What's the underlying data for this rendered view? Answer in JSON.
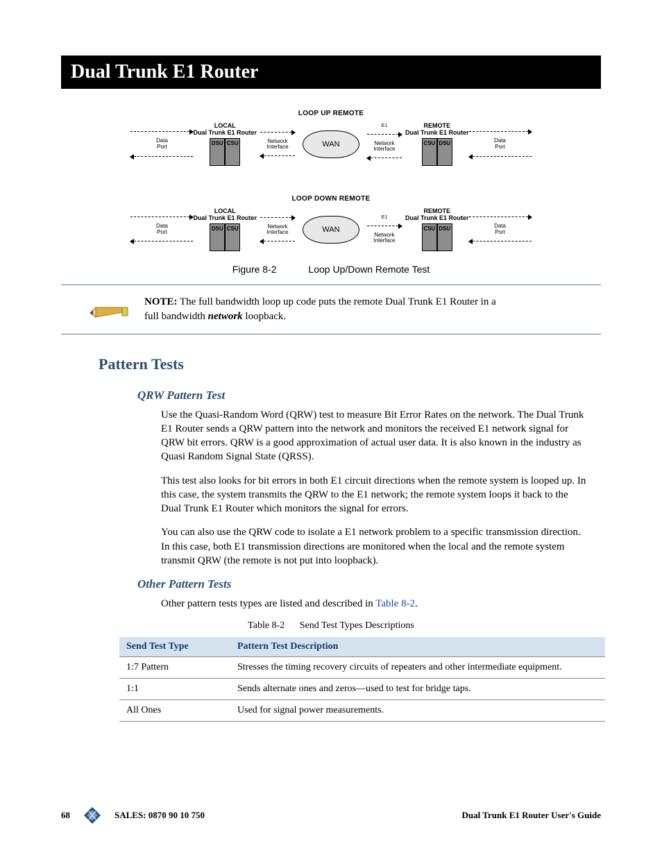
{
  "title": "Dual Trunk E1 Router",
  "diagram": {
    "loop_up_title": "LOOP UP REMOTE",
    "loop_down_title": "LOOP DOWN REMOTE",
    "local_label_l1": "LOCAL",
    "local_label_l2": "Dual Trunk E1 Router",
    "remote_label_l1": "REMOTE",
    "remote_label_l2": "Dual Trunk E1 Router",
    "dsu": "DSU",
    "csu": "CSU",
    "data_port_l1": "Data",
    "data_port_l2": "Port",
    "netif_l1": "Network",
    "netif_l2": "Interface",
    "e1": "E1",
    "wan": "WAN"
  },
  "figure": {
    "label": "Figure 8-2",
    "caption": "Loop Up/Down Remote Test"
  },
  "note": {
    "prefix": "NOTE:",
    "text_before": " The full bandwidth loop up code puts the remote Dual Trunk E1 Router in a full bandwidth ",
    "emphasis": "network",
    "text_after": " loopback."
  },
  "sections": {
    "pattern_tests": "Pattern Tests",
    "qrw_title": "QRW Pattern Test",
    "qrw_p1": "Use the Quasi-Random Word (QRW) test to measure Bit Error Rates on the  network. The Dual Trunk E1 Router sends a QRW pattern into the network and monitors the received E1 network signal for QRW bit errors. QRW is a good approximation of actual user data. It is also known in the industry as Quasi Random Signal State (QRSS).",
    "qrw_p2": "This test also looks for bit errors in both E1 circuit directions when the remote system is looped up. In this case, the system transmits the QRW to the E1 network; the remote system loops it back to the Dual Trunk E1 Router which monitors the signal for errors.",
    "qrw_p3": "You can also use the QRW code to isolate a E1 network problem to a specific transmission direction. In this case, both E1 transmission directions are monitored when the local and the remote system transmit QRW (the remote is not put into loopback).",
    "other_title": "Other Pattern Tests",
    "other_intro_before": "Other pattern tests types are listed and described in ",
    "other_intro_link": "Table 8-2",
    "other_intro_after": "."
  },
  "table": {
    "label": "Table 8-2",
    "caption": "Send Test Types Descriptions",
    "headers": {
      "c1": "Send Test Type",
      "c2": "Pattern Test Description"
    },
    "rows": [
      {
        "c1": "1:7 Pattern",
        "c2": "Stresses the timing recovery circuits of repeaters and other intermediate equipment."
      },
      {
        "c1": "1:1",
        "c2": "Sends alternate ones and zeros—used to test for bridge taps."
      },
      {
        "c1": "All Ones",
        "c2": "Used for signal power measurements."
      }
    ]
  },
  "footer": {
    "page": "68",
    "sales": "SALES:  0870 90 10 750",
    "guide": "Dual Trunk E1 Router User's Guide"
  }
}
